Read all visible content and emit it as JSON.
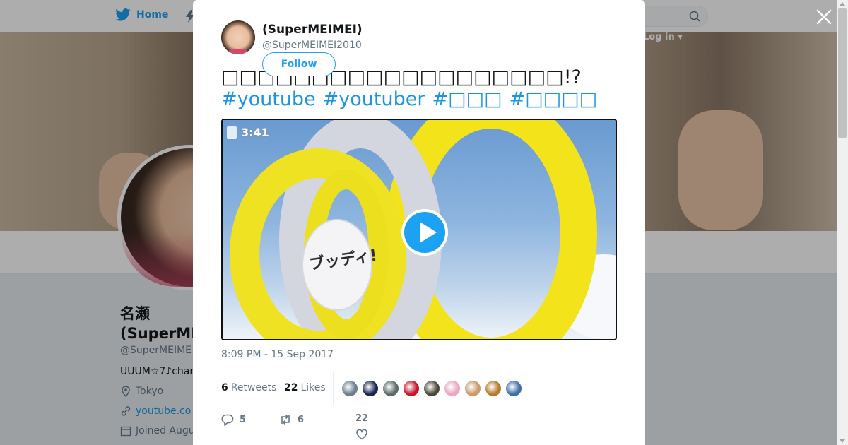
{
  "topnav": {
    "home_label": "Home",
    "login_label": "Log in",
    "icons": [
      "twitter-bird-icon",
      "moments-icon",
      "search-icon"
    ]
  },
  "profile": {
    "name": "名瀬(SuperMEIMEI)",
    "handle": "@SuperMEIME",
    "desc": "UUUM☆7♪char",
    "location": "Tokyo",
    "link": "youtube.co",
    "joined": "Joined Augu"
  },
  "tweet": {
    "author_name": "(SuperMEIMEI)",
    "author_handle": "@SuperMEIMEI2010",
    "follow_label": "Follow",
    "text": "□□□□□□□□□□□□□□□□□□□!?",
    "hashtags": [
      "#youtube",
      "#youtuber",
      "#□□□",
      "#□□□□"
    ],
    "media": {
      "timer": "3:41",
      "disc_text": "ブッディ!"
    },
    "timestamp": "8:09 PM - 15 Sep 2017",
    "retweets_count": "6",
    "retweets_label": "Retweets",
    "likes_count": "22",
    "likes_label": "Likes",
    "likers": [
      "#6d7e8e",
      "#1a2650",
      "#5a6c6a",
      "#c8152a",
      "#4b4a3a",
      "#e8a7c2",
      "#c99a6a",
      "#b77b2e",
      "#3f6ea8"
    ],
    "actions": {
      "reply_count": "5",
      "retweet_count": "6",
      "like_count": "22"
    }
  },
  "colors": {
    "accent": "#1da1f2",
    "link": "#1b95e0",
    "muted": "#657786"
  }
}
